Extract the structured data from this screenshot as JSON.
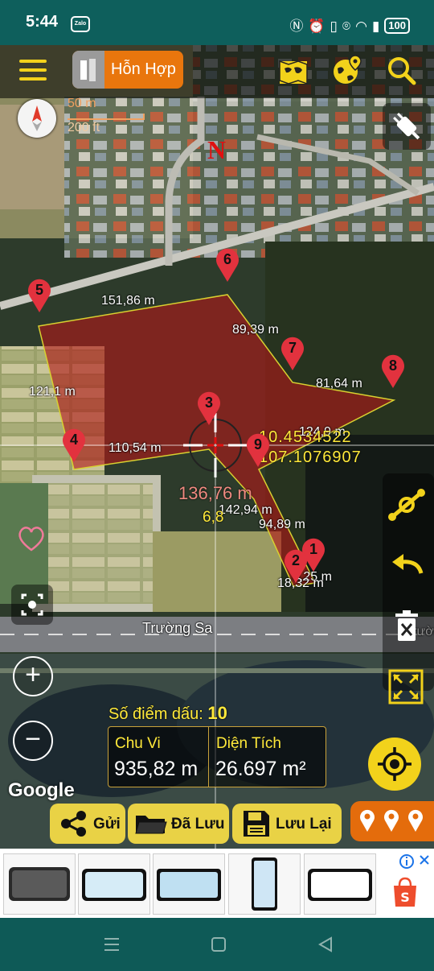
{
  "status_bar": {
    "time": "5:44",
    "zalo": "Zalo",
    "battery": "100"
  },
  "toolbar": {
    "mode_label": "Hỗn Hợp"
  },
  "scale": {
    "metric": "50 m",
    "imperial": "200 ft"
  },
  "compass": {
    "north": "N"
  },
  "distance_labels": [
    {
      "id": "d-151",
      "text": "151,86 m"
    },
    {
      "id": "d-89",
      "text": "89,39 m"
    },
    {
      "id": "d-81",
      "text": "81,64 m"
    },
    {
      "id": "d-121",
      "text": "121,1 m"
    },
    {
      "id": "d-124",
      "text": "124,9 m"
    },
    {
      "id": "d-110",
      "text": "110,54 m"
    },
    {
      "id": "d-136",
      "text": "136,76 m"
    },
    {
      "id": "d-142",
      "text": "142,94 m"
    },
    {
      "id": "d-94",
      "text": "94,89 m"
    },
    {
      "id": "d-68",
      "text": "6,8"
    },
    {
      "id": "d-025",
      "text": "0,25 m"
    },
    {
      "id": "d-18",
      "text": "18,32 m"
    }
  ],
  "markers": [
    "1",
    "2",
    "3",
    "4",
    "5",
    "6",
    "7",
    "8",
    "9"
  ],
  "crosshair": {
    "lat": "10.4534522",
    "lon": "107.1076907"
  },
  "road_label": "Trường Sa",
  "road_label_right": "Trường",
  "stats": {
    "points_label": "Số điểm dấu:",
    "points_value": "10",
    "perimeter_label": "Chu Vi",
    "perimeter_value": "935,82 m",
    "area_label": "Diện Tích",
    "area_value": "26.697 m²"
  },
  "google_logo": "Google",
  "bottom_bar": {
    "send": "Gửi",
    "saved": "Đã Lưu",
    "save": "Lưu Lại"
  },
  "colors": {
    "accent_yellow": "#f2d21b",
    "accent_orange": "#e9760d",
    "polygon": "#b01818",
    "teal": "#0e5a57"
  }
}
